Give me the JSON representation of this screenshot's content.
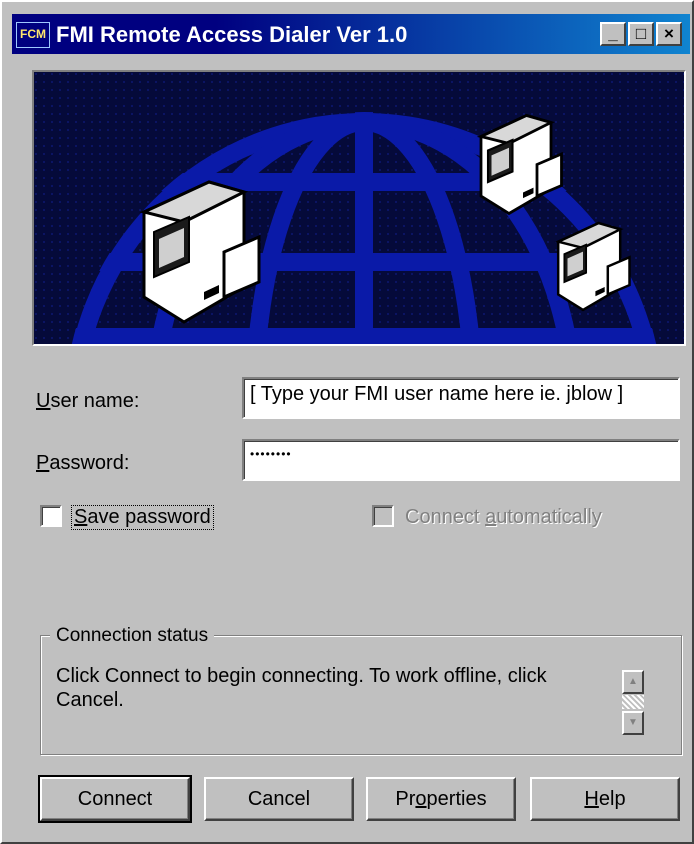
{
  "window": {
    "title": "FMI Remote Access Dialer Ver 1.0",
    "icon_text": "FCM",
    "controls": {
      "minimize": "_",
      "maximize": "□",
      "close": "×"
    }
  },
  "form": {
    "username": {
      "label_hotkey": "U",
      "label_rest": "ser name:",
      "value": "[ Type your FMI user name here ie. jblow ]"
    },
    "password": {
      "label_hotkey": "P",
      "label_rest": "assword:",
      "value": "••••••••"
    },
    "save_password": {
      "label_hotkey": "S",
      "label_rest": "ave password",
      "checked": false
    },
    "connect_automatically": {
      "label_pre": "Connect ",
      "label_hotkey": "a",
      "label_rest": "utomatically",
      "checked": false,
      "enabled": false
    }
  },
  "status": {
    "group_title": "Connection status",
    "text": "Click Connect to begin connecting.  To work offline, click Cancel."
  },
  "buttons": {
    "connect": "Connect",
    "cancel": "Cancel",
    "properties_pre": "Pr",
    "properties_hotkey": "o",
    "properties_rest": "perties",
    "help_hotkey": "H",
    "help_rest": "elp"
  },
  "colors": {
    "titlebar": "#000080",
    "banner_background": "#050a3a",
    "globe": "#0a1aa8",
    "face": "#c0c0c0"
  },
  "icons": [
    "computer-icon",
    "globe-graphic",
    "up-arrow-icon",
    "down-arrow-icon"
  ]
}
